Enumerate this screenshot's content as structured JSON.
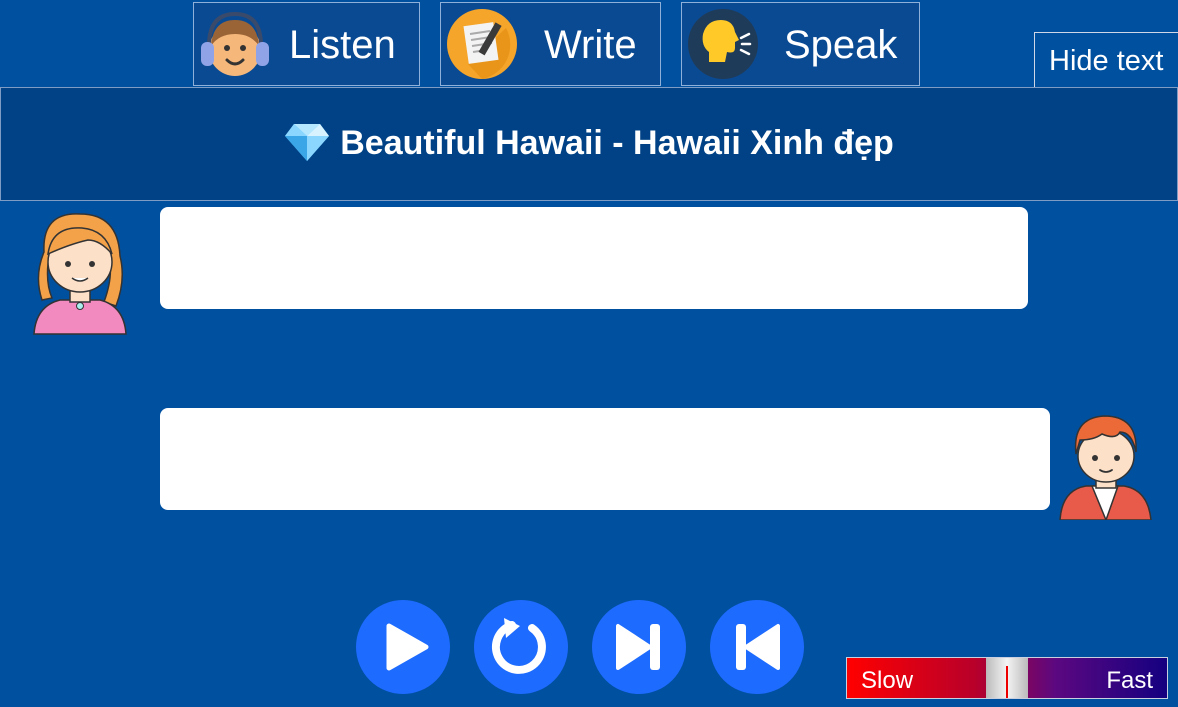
{
  "tabs": {
    "listen": {
      "label": "Listen",
      "icon": "headphones-kid-icon"
    },
    "write": {
      "label": "Write",
      "icon": "notepad-pencil-icon"
    },
    "speak": {
      "label": "Speak",
      "icon": "speaking-head-icon"
    }
  },
  "hide_text_label": "Hide text",
  "lesson": {
    "icon": "diamond-icon",
    "title": "Beautiful Hawaii - Hawaii Xinh đẹp"
  },
  "dialogue": [
    {
      "speaker": "girl",
      "text": ""
    },
    {
      "speaker": "boy",
      "text": ""
    }
  ],
  "controls": {
    "play": "play-icon",
    "replay": "replay-icon",
    "next": "skip-next-icon",
    "previous": "skip-previous-icon"
  },
  "speed": {
    "slow_label": "Slow",
    "fast_label": "Fast",
    "value": 0.5
  },
  "colors": {
    "background": "#0050a0",
    "title_bar": "#004285",
    "control_button": "#1e6bff"
  }
}
